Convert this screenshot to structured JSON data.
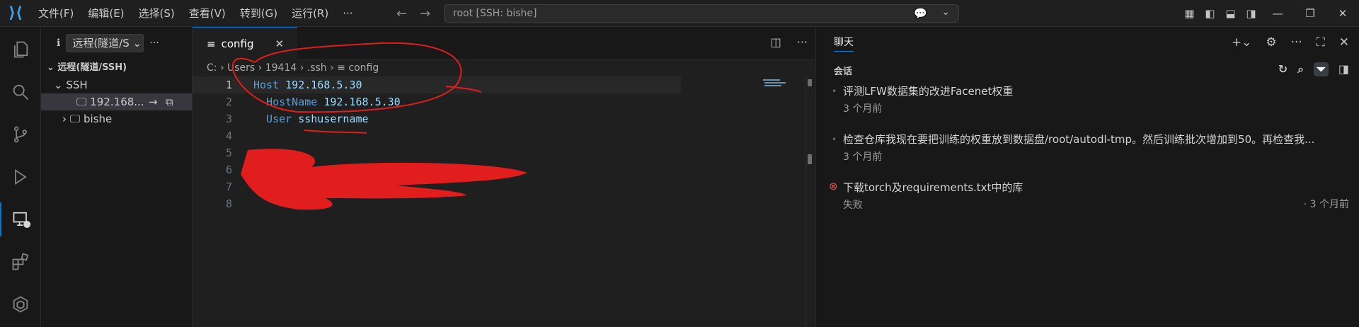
{
  "titlebar": {
    "menu": [
      "文件(F)",
      "编辑(E)",
      "选择(S)",
      "查看(V)",
      "转到(G)",
      "运行(R)",
      "···"
    ],
    "command_center": "root [SSH: bishe]",
    "logo_icon": "vscode-logo-icon"
  },
  "sidebar": {
    "header_info": "ℹ",
    "select_value": "远程(隧道/S",
    "more": "···",
    "section": "远程(隧道/SSH)",
    "group": "SSH",
    "items": [
      {
        "label": "192.168...",
        "selected": true
      },
      {
        "label": "bishe",
        "selected": false
      }
    ]
  },
  "editor": {
    "tab": {
      "label": "config",
      "close": "✕"
    },
    "breadcrumb": [
      "C:",
      "Users",
      "19414",
      ".ssh",
      "config"
    ],
    "lines": [
      {
        "num": "1",
        "parts": [
          {
            "cls": "kw",
            "text": "Host"
          },
          {
            "cls": "val",
            "text": " 192.168.5.30"
          }
        ]
      },
      {
        "num": "2",
        "parts": [
          {
            "cls": "kw",
            "text": "  HostName"
          },
          {
            "cls": "val",
            "text": " 192.168.5.30"
          }
        ]
      },
      {
        "num": "3",
        "parts": [
          {
            "cls": "kw",
            "text": "  User"
          },
          {
            "cls": "val",
            "text": " sshusername"
          }
        ]
      },
      {
        "num": "4",
        "parts": []
      },
      {
        "num": "5",
        "parts": []
      },
      {
        "num": "6",
        "parts": []
      },
      {
        "num": "7",
        "parts": []
      },
      {
        "num": "8",
        "parts": []
      }
    ]
  },
  "chat": {
    "tab": "聊天",
    "section": "会话",
    "sessions": [
      {
        "title": "评测LFW数据集的改进Facenet权重",
        "sub": "3 个月前",
        "failed": false,
        "right": ""
      },
      {
        "title": "检查仓库我现在要把训练的权重放到数据盘/root/autodl-tmp。然后训练批次增加到50。再检查我...",
        "sub": "3 个月前",
        "failed": false,
        "right": ""
      },
      {
        "title": "下载torch及requirements.txt中的库",
        "sub": "失败",
        "failed": true,
        "right": "· 3 个月前"
      }
    ]
  },
  "colors": {
    "accent": "#0078d4",
    "keyword": "#569cd6",
    "value": "#9cdcfe",
    "error": "#f14c4c",
    "annotation": "#e11d1d"
  }
}
